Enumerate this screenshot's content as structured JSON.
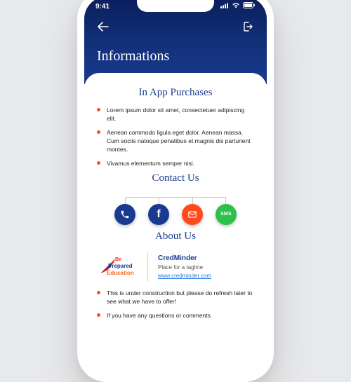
{
  "status": {
    "time": "9:41"
  },
  "header": {
    "title": "Informations"
  },
  "sections": {
    "purchases": {
      "title": "In App Purchases",
      "items": [
        "Lorem ipsum dolor sit amet, consectetuer adipiscing elit.",
        "Aenean commodo ligula eget dolor. Aenean massa. Cum sociis natoque penatibus et magnis dis parturient montes.",
        "Vivamus elementum semper nisi."
      ]
    },
    "contact": {
      "title": "Contact Us"
    },
    "about": {
      "title": "About Us",
      "brand": "CredMinder",
      "tagline": "Place for a tagline",
      "link": "www.credminder.com",
      "logo_line1": "Be",
      "logo_line2": "Prepared",
      "logo_line3": "Education",
      "items": [
        "This is under construction but please do refresh later to see what we have to offer!",
        "If you have any questions or comments"
      ]
    }
  }
}
